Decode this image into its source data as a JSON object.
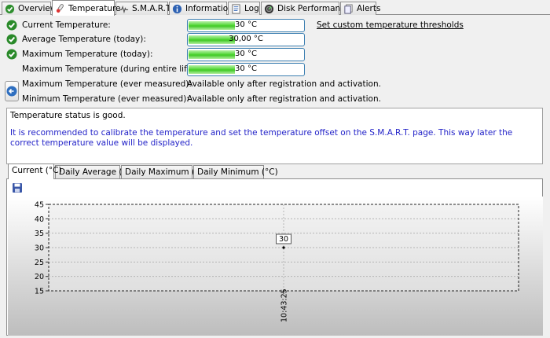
{
  "tabs": [
    {
      "label": "Overview",
      "icon": "overview-icon",
      "active": false
    },
    {
      "label": "Temperature",
      "icon": "thermometer-icon",
      "active": true
    },
    {
      "label": "S.M.A.R.T.",
      "icon": "smart-icon",
      "active": false
    },
    {
      "label": "Information",
      "icon": "info-icon",
      "active": false
    },
    {
      "label": "Log",
      "icon": "log-icon",
      "active": false
    },
    {
      "label": "Disk Performance",
      "icon": "disk-performance-icon",
      "active": false
    },
    {
      "label": "Alerts",
      "icon": "alerts-icon",
      "active": false
    }
  ],
  "temperature": {
    "current": {
      "label": "Current Temperature:",
      "value": "30 °C",
      "level": 0.4
    },
    "average": {
      "label": "Average Temperature (today):",
      "value": "30,00 °C",
      "level": 0.4
    },
    "max_today": {
      "label": "Maximum Temperature (today):",
      "value": "30 °C",
      "level": 0.4
    },
    "max_lifespan": {
      "label": "Maximum Temperature (during entire lifespan):",
      "value": "30 °C",
      "level": 0.4
    },
    "max_ever": {
      "label": "Maximum Temperature (ever measured):",
      "value": "Available only after registration and activation."
    },
    "min_ever": {
      "label": "Minimum Temperature (ever measured):",
      "value": "Available only after registration and activation."
    },
    "thresholds_link": "Set custom temperature thresholds"
  },
  "status": {
    "message": "Temperature status is good.",
    "recommendation": "It is recommended to calibrate the temperature and set the temperature offset on the S.M.A.R.T. page. This way later the correct temperature value will be displayed."
  },
  "chart_tabs": [
    {
      "label": "Current (°C)",
      "active": true
    },
    {
      "label": "Daily Average (°C)",
      "active": false
    },
    {
      "label": "Daily Maximum (°C)",
      "active": false
    },
    {
      "label": "Daily Minimum (°C)",
      "active": false
    }
  ],
  "colors": {
    "accent": "#3c7fb1",
    "ok_green": "#3fc925",
    "recommendation": "#2323c8"
  },
  "chart_data": {
    "type": "line",
    "x": [
      "10:43:25"
    ],
    "series": [
      {
        "values": [
          30
        ],
        "labels": [
          "30"
        ]
      }
    ],
    "ylim": [
      15,
      45
    ],
    "yticks": [
      15,
      20,
      25,
      30,
      35,
      40,
      45
    ],
    "xlabel": "",
    "ylabel": "",
    "grid": true
  }
}
